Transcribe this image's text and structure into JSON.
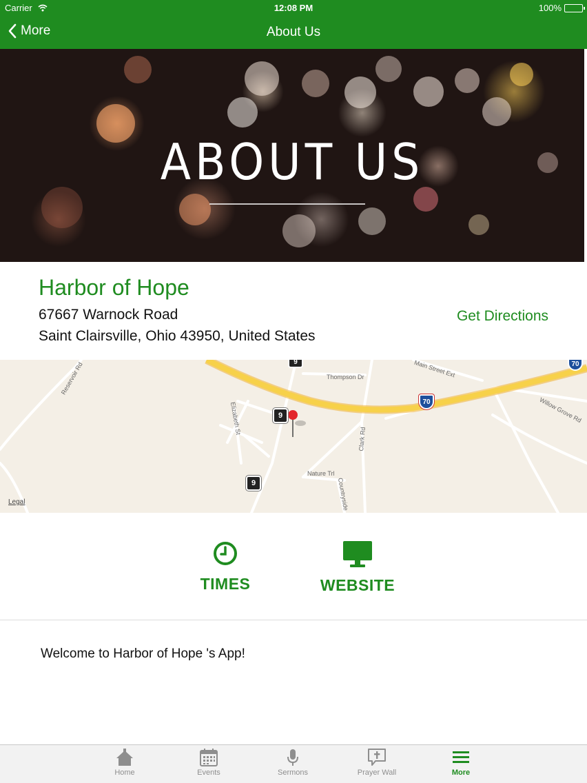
{
  "status_bar": {
    "carrier": "Carrier",
    "time": "12:08 PM",
    "battery": "100%"
  },
  "nav": {
    "back_label": "More",
    "title": "About Us"
  },
  "hero": {
    "heading": "ABOUT US"
  },
  "church": {
    "name": "Harbor of Hope",
    "address_line1": "67667 Warnock Road",
    "address_line2": "Saint Clairsville, Ohio 43950, United States",
    "directions_label": "Get Directions"
  },
  "map": {
    "legal": "Legal",
    "labels": {
      "thompson": "Thompson Dr",
      "reservoir": "Reservoir Rd",
      "elizabeth": "Elizabeth St",
      "clark": "Clark Rd",
      "nature": "Nature Trl",
      "countryside": "Countryside",
      "street_ext": "Main Street Ext",
      "willow": "Willow Grove Rd"
    },
    "shields": {
      "route9": "9",
      "i70": "70"
    }
  },
  "actions": {
    "times": "TIMES",
    "website": "WEBSITE"
  },
  "welcome_text": "Welcome to Harbor of Hope 's App!",
  "tabs": [
    {
      "label": "Home",
      "icon": "home-icon"
    },
    {
      "label": "Events",
      "icon": "calendar-icon"
    },
    {
      "label": "Sermons",
      "icon": "microphone-icon"
    },
    {
      "label": "Prayer Wall",
      "icon": "prayer-icon"
    },
    {
      "label": "More",
      "icon": "menu-icon"
    }
  ],
  "colors": {
    "brand_green": "#1f8c20",
    "tab_inactive": "#8e8e8e",
    "highway_yellow": "#f7d14a"
  }
}
